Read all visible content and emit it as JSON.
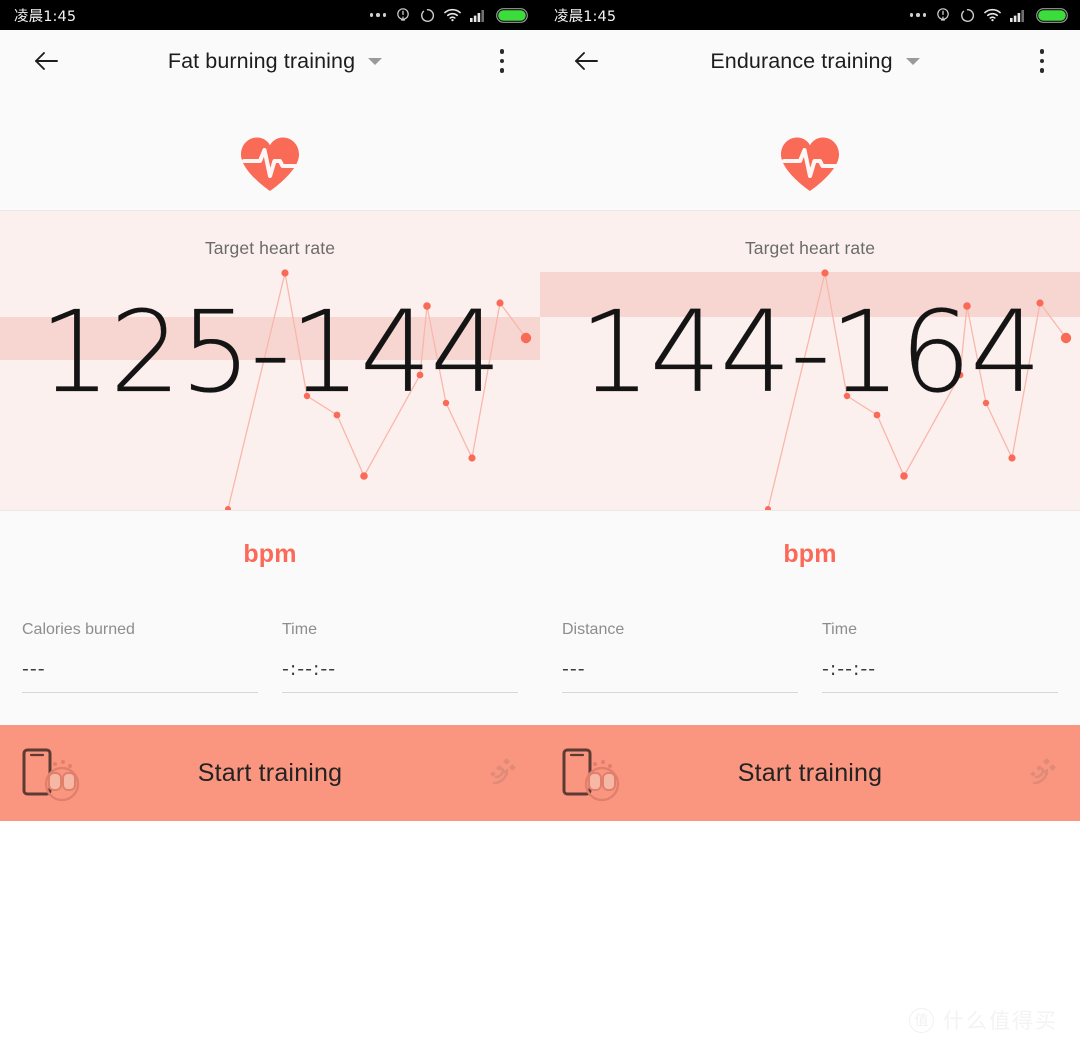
{
  "status_bar": {
    "time": "凌晨1:45",
    "icons": [
      "more-dots-icon",
      "alarm-icon",
      "sync-icon",
      "wifi-icon",
      "signal-icon",
      "battery-icon"
    ],
    "battery_color": "#3ddc3d",
    "background": "#000000"
  },
  "panes": [
    {
      "header": {
        "back_icon": "back-arrow-icon",
        "title": "Fat burning training",
        "caret_icon": "chevron-down-icon",
        "menu_icon": "kebab-menu-icon"
      },
      "heart_icon": "heart-pulse-icon",
      "heart_color": "#f96a57",
      "hr": {
        "label": "Target heart rate",
        "value": "125-144",
        "unit": "bpm",
        "unit_color": "#fb6a58",
        "panel_bg": "#fcf0ee",
        "band_color": "#f7d6d1",
        "band_top": 106,
        "band_height": 43
      },
      "stats": [
        {
          "label": "Calories burned",
          "value": "---"
        },
        {
          "label": "Time",
          "value": "-:--:--"
        }
      ],
      "start": {
        "label": "Start training",
        "bg": "#fa9680",
        "device_icon": "phone-and-band-icon",
        "gps_icon": "gps-satellite-icon"
      }
    },
    {
      "header": {
        "back_icon": "back-arrow-icon",
        "title": "Endurance training",
        "caret_icon": "chevron-down-icon",
        "menu_icon": "kebab-menu-icon"
      },
      "heart_icon": "heart-pulse-icon",
      "heart_color": "#f96a57",
      "hr": {
        "label": "Target heart rate",
        "value": "144-164",
        "unit": "bpm",
        "unit_color": "#fb6a58",
        "panel_bg": "#fcf0ee",
        "band_color": "#f7d6d1",
        "band_top": 61,
        "band_height": 45
      },
      "stats": [
        {
          "label": "Distance",
          "value": "---"
        },
        {
          "label": "Time",
          "value": "-:--:--"
        }
      ],
      "start": {
        "label": "Start training",
        "bg": "#fa9680",
        "device_icon": "phone-and-band-icon",
        "gps_icon": "gps-satellite-icon"
      }
    }
  ],
  "chart_data": {
    "type": "scatter",
    "title": "Target heart rate trace",
    "xlabel": "",
    "ylabel": "bpm",
    "grid": false,
    "legend": false,
    "line_color": "#f9b7ac",
    "point_color": "#f96a57",
    "xlim": [
      0,
      540
    ],
    "ylim": [
      0,
      301
    ],
    "note": "decorative heart-rate trace rendered identically behind both panels; coordinates are panel-local pixels",
    "points": [
      {
        "x": 228,
        "y": 298,
        "r": 3.0
      },
      {
        "x": 285,
        "y": 62,
        "r": 3.6
      },
      {
        "x": 307,
        "y": 185,
        "r": 3.2
      },
      {
        "x": 337,
        "y": 204,
        "r": 3.4
      },
      {
        "x": 364,
        "y": 265,
        "r": 3.8
      },
      {
        "x": 420,
        "y": 164,
        "r": 3.4
      },
      {
        "x": 427,
        "y": 95,
        "r": 3.8
      },
      {
        "x": 446,
        "y": 192,
        "r": 3.2
      },
      {
        "x": 472,
        "y": 247,
        "r": 3.6
      },
      {
        "x": 500,
        "y": 92,
        "r": 3.6
      },
      {
        "x": 526,
        "y": 127,
        "r": 5.2
      }
    ]
  },
  "watermark": {
    "badge": "值",
    "text": "什么值得买"
  }
}
